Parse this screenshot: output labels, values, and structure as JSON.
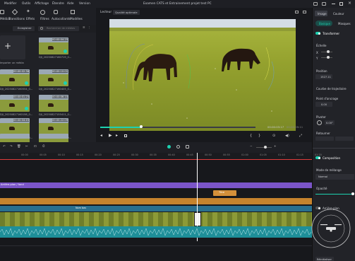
{
  "menu": {
    "items": [
      "Modifier",
      "Outils",
      "Affichage",
      "Étendre",
      "Aide",
      "Version"
    ],
    "window_title": "Examen CATS et Entrainement projet test PC"
  },
  "toolbar": {
    "tabs": [
      "Médias",
      "Transitions",
      "Effets",
      "Filtres",
      "Autocollants",
      "Modèles"
    ]
  },
  "media": {
    "import_label": "Importer un média",
    "folder_button": "Enregistrer",
    "search_placeholder": "Rechercher de médias",
    "items": [
      {
        "name": "DJI_20250827160719_0...",
        "duration": "00:00:04:25",
        "checked": true
      },
      {
        "name": "DJI_20250827160554_0...",
        "duration": "00:00:02:36",
        "checked": true
      },
      {
        "name": "DJI_20250827160405_0...",
        "duration": "00:00:10:01",
        "checked": true
      },
      {
        "name": "DJI_20250827160158_0...",
        "duration": "00:00:01:25",
        "checked": true
      },
      {
        "name": "DJI_20250827155411_0...",
        "duration": "00:00:06:10",
        "checked": false
      },
      {
        "name": "DJI_20250827153804_0...",
        "duration": "00:00:04:45",
        "checked": false
      },
      {
        "name": "DJI_20250827151314_0...",
        "duration": "00:00:22:09",
        "checked": false
      },
      {
        "name": "",
        "duration": "",
        "checked": false
      },
      {
        "name": "",
        "duration": "",
        "checked": false
      }
    ],
    "overlay_badge": "Ajouté à la timeline"
  },
  "viewer": {
    "label": "Lecteur",
    "quality": "Qualité optimale",
    "current_time": "00:00:03:17",
    "total_time": "00:00:09:11"
  },
  "props": {
    "tabs": [
      "Image",
      "Couleur"
    ],
    "subtabs": [
      "Basique",
      "Masques"
    ],
    "transform_label": "Transformer",
    "scale_label": "Échelle",
    "x_label": "X",
    "x_value": "100.00",
    "y_label": "Y",
    "y_value": "100.00",
    "position_label": "Position",
    "pos_x": "1527.11",
    "pos_y": "-1051.12",
    "trajectory_label": "Courbe de trajectoire",
    "anchor_label": "Point d'ancrage",
    "anchor_x": "0.00",
    "anchor_y": "0.00",
    "rotate_label": "Pivoter",
    "rotate_value": "0.00°",
    "flip_label": "Retourner",
    "compose_label": "Composition",
    "blend_label": "Mode de mélange",
    "blend_value": "Normal",
    "opacity_label": "Opacité",
    "opacity_value": "100",
    "bg_label": "Arrière-plan",
    "reset_label": "Réinitialiser"
  },
  "timeline": {
    "ruler": [
      "00:00",
      "00:05",
      "00:10",
      "00:15",
      "00:20",
      "00:25",
      "00:30",
      "00:35",
      "00:40",
      "00:45",
      "00:50",
      "00:55",
      "01:00",
      "01:05",
      "01:10",
      "01:15",
      "01:20"
    ],
    "track_fond": "Arrière-plan / fond",
    "clip_title": "Nom bas",
    "title_clip": "Titre",
    "video_label": "Normal Vidéo"
  },
  "watermark": {
    "top": "SERVICE DRONE 82",
    "bottom": "PRISE DE VUE AÉRIENNE"
  },
  "colors": {
    "accent": "#1dd1b0",
    "purple": "#7b55c8",
    "orange": "#c6832d",
    "teal": "#1e8f99",
    "blue": "#2a6f8e"
  }
}
